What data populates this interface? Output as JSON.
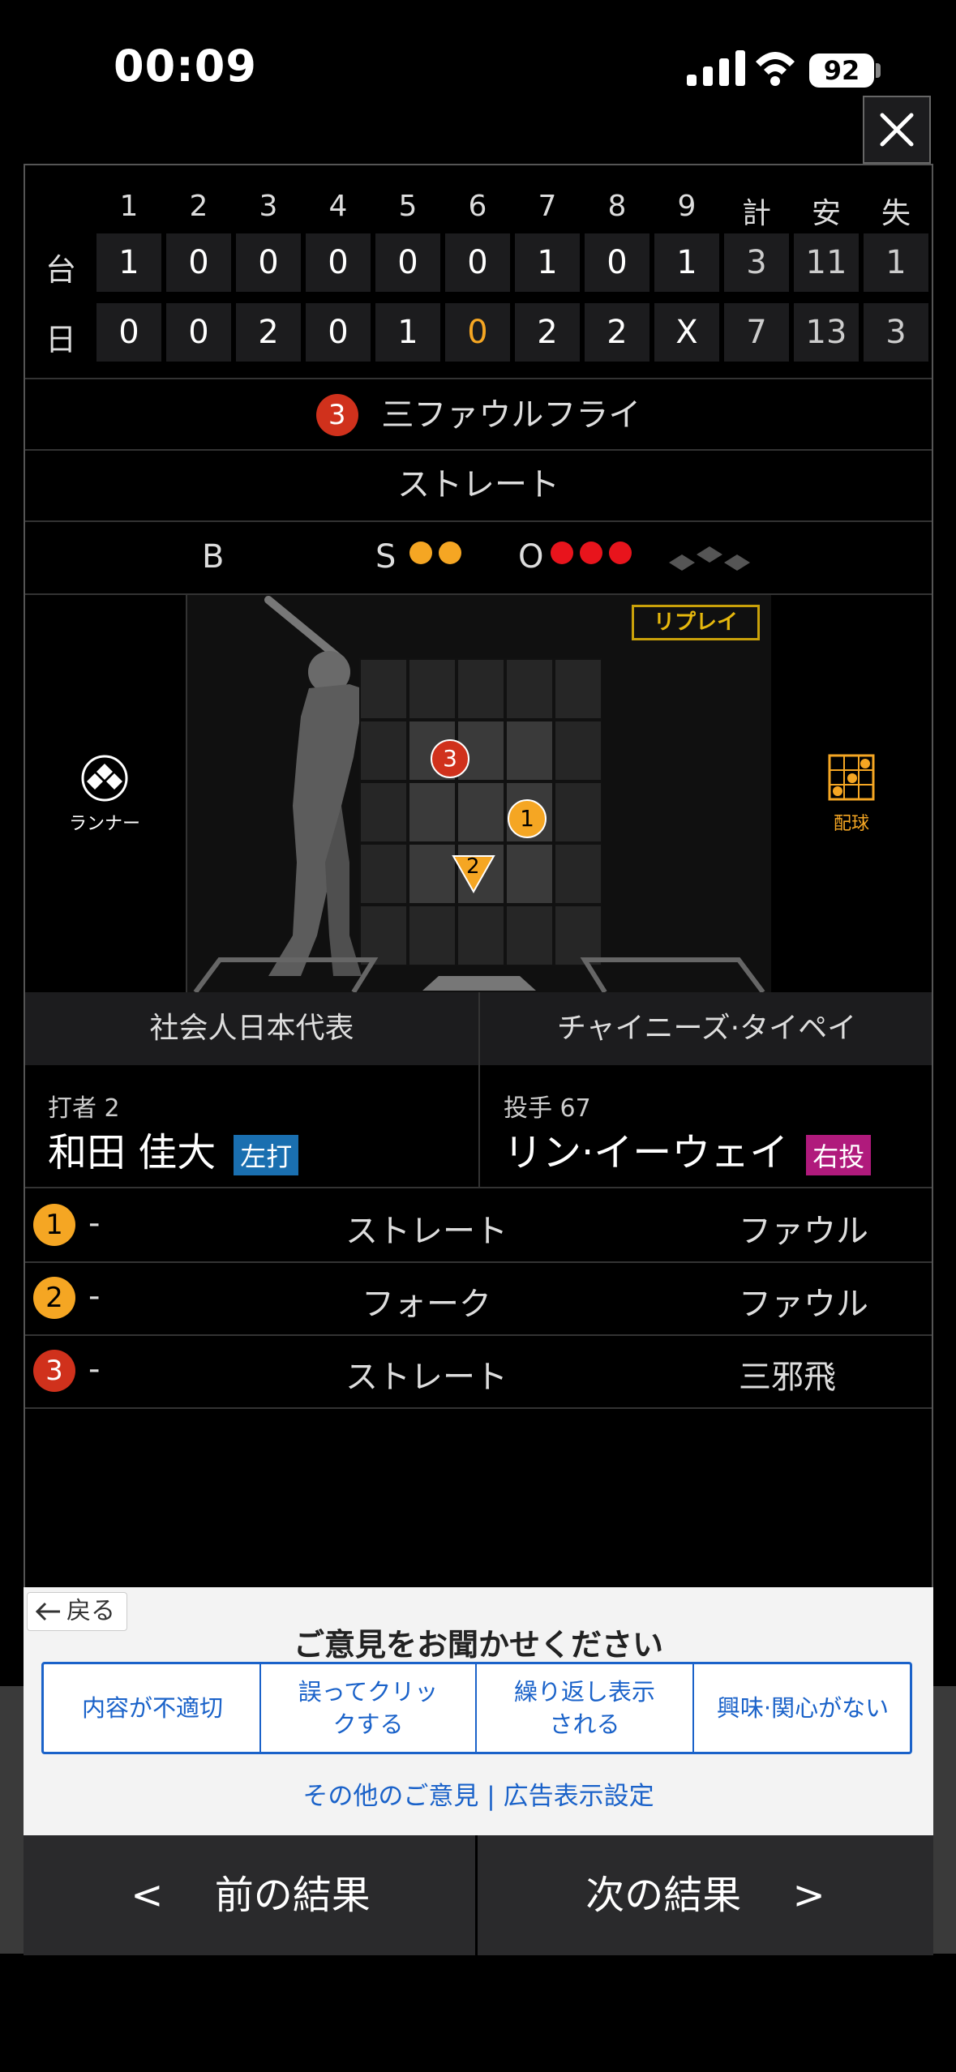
{
  "status": {
    "time": "00:09",
    "battery": "92"
  },
  "scoreboard": {
    "innings": [
      "1",
      "2",
      "3",
      "4",
      "5",
      "6",
      "7",
      "8",
      "9",
      "計",
      "安",
      "失"
    ],
    "teams": [
      {
        "abbr": "台",
        "scores": [
          "1",
          "0",
          "0",
          "0",
          "0",
          "0",
          "1",
          "0",
          "1",
          "3",
          "11",
          "1"
        ]
      },
      {
        "abbr": "日",
        "scores": [
          "0",
          "0",
          "2",
          "0",
          "1",
          "0",
          "2",
          "2",
          "X",
          "7",
          "13",
          "3"
        ]
      }
    ]
  },
  "play": {
    "badge": "3",
    "text": "三ファウルフライ"
  },
  "pitch_type": "ストレート",
  "count": {
    "b_label": "B",
    "s_label": "S",
    "o_label": "O",
    "balls": 0,
    "strikes": 2,
    "outs": 3
  },
  "field": {
    "runner_label": "ランナー",
    "pattern_label": "配球",
    "replay_label": "リプレイ",
    "pitches": [
      {
        "num": "1",
        "color": "#f5a623"
      },
      {
        "num": "2",
        "color": "#f5a623"
      },
      {
        "num": "3",
        "color": "#d0311c"
      }
    ]
  },
  "teams": {
    "home": "社会人日本代表",
    "away": "チャイニーズ·タイペイ"
  },
  "batter": {
    "label": "打者 2",
    "name": "和田 佳大",
    "hand": "左打"
  },
  "pitcher": {
    "label": "投手 67",
    "name": "リン·イーウェイ",
    "hand": "右投"
  },
  "pitch_list": [
    {
      "num": "1",
      "speed": "-",
      "type": "ストレート",
      "result": "ファウル",
      "badge": "yellow"
    },
    {
      "num": "2",
      "speed": "-",
      "type": "フォーク",
      "result": "ファウル",
      "badge": "yellow"
    },
    {
      "num": "3",
      "speed": "-",
      "type": "ストレート",
      "result": "三邪飛",
      "badge": "red"
    }
  ],
  "ad": {
    "back": "戻る",
    "title": "ご意見をお聞かせください",
    "options": [
      "内容が不適切",
      "誤ってクリックする",
      "繰り返し表示される",
      "興味·関心がない"
    ],
    "links": "その他のご意見 | 広告表示設定"
  },
  "nav": {
    "prev": "<　 前の結果",
    "next": "次の結果　 >"
  },
  "colors": {
    "accent_yellow": "#f5a623",
    "accent_red": "#d0311c",
    "batter_hand": "#1a6fb0",
    "pitcher_hand": "#b01a7c",
    "link_blue": "#1a62c9"
  }
}
